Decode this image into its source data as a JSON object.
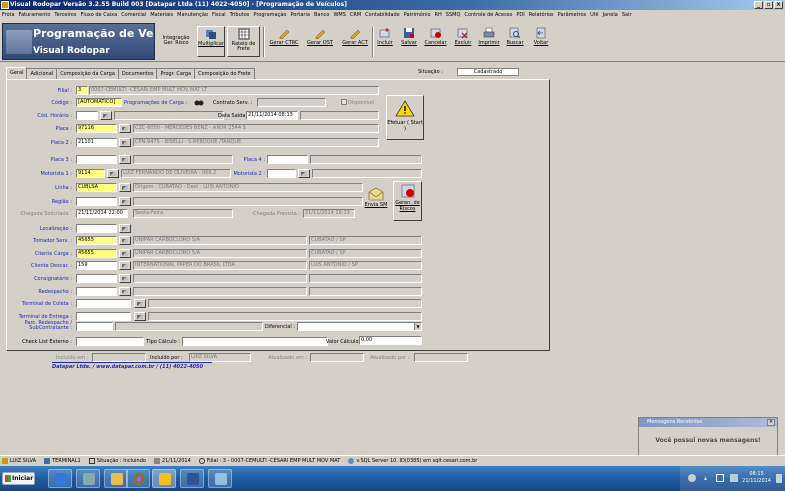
{
  "window": {
    "title": "Visual Rodopar Versão 3.2.55 Build 003 [Datapar Ltda (11) 4022-4050] - [Programação de Veículos]"
  },
  "menu": [
    "Frota",
    "Faturamento",
    "Terceiros",
    "Fluxo de Caixa",
    "Comercial",
    "Materiais",
    "Manutenção",
    "Fiscal",
    "Tributos",
    "Programação",
    "Portaria",
    "Banco",
    "WMS",
    "CRM",
    "Contabilidade",
    "Patrimônio",
    "RH",
    "SSMQ",
    "Controle de Acesso",
    "PDI",
    "Relatórios",
    "Parâmetros",
    "Util",
    "Janela",
    "Sair"
  ],
  "banner": {
    "title": "Programação de Ve",
    "subtitle": "Visual Rodopar"
  },
  "toolbar": {
    "integracao": "Integração Ger. Risco",
    "multiplicar": "Multiplicar",
    "rateio": "Rateio de Frete",
    "gerar_ctrc": "Gerar CTRC",
    "gerar_ost": "Gerar OST",
    "gerar_act": "Gerar ACT",
    "incluir": "Incluir",
    "salvar": "Salvar",
    "cancelar": "Cancelar",
    "excluir": "Excluir",
    "imprimir": "Imprimir",
    "buscar": "Buscar",
    "voltar": "Voltar"
  },
  "tabs": [
    "Geral",
    "Adicional",
    "Composição da Carga",
    "Documentos",
    "Progr. Carga",
    "Composição do Frete"
  ],
  "situacao": {
    "label": "Situação :",
    "value": "Cadastrado"
  },
  "form": {
    "filial": {
      "label": "Filial :",
      "code": "3",
      "desc": "0007-CEMULTI -CESARI EMP MULT MOV MAT LT"
    },
    "codigo": {
      "label": "Código :",
      "value": "[AUTOMATICO]",
      "programacoes": "Programações de Carga :",
      "contrato_label": "Contrato Serv. :",
      "disponivel": "Disponível"
    },
    "cod_horario": {
      "label": "Cód. Horário :",
      "saida_label": "Data Saída :",
      "saida": "21/11/2014 08:13"
    },
    "placa": {
      "label": "Placa :",
      "code": "97116",
      "desc": "CZC-6050 - MERCEDES BENZ - AXOR 2544 S"
    },
    "placa2": {
      "label": "Placa 2 :",
      "code": "21101",
      "desc": "CPN-9475 - BISELLI - S.REBOQUE /TANQUE"
    },
    "placa3": {
      "label": "Placa 3 :",
      "placa4_label": "Placa 4 :"
    },
    "motorista1": {
      "label": "Motorista 1 :",
      "code": "9114",
      "desc": "LUIZ FERNANDO DE OLIVEIRA - 066.2",
      "mot2_label": "Motorista 2 :"
    },
    "linha": {
      "label": "Linha :",
      "code": "CUBLSA",
      "desc": "Origem : CUBATAO - Dest : LUIS ANTONIO"
    },
    "regiao": {
      "label": "Região :"
    },
    "chegada": {
      "label": "Chegada Solicitada :",
      "value": "21/11/2014 22:00",
      "dia": "Sexta-Feira",
      "prevista_label": "Chegada Prevista :",
      "prevista": "21/11/2014 16:13"
    },
    "localizacao": {
      "label": "Localização :"
    },
    "tomador": {
      "label": "Tomador Serv. :",
      "code": "45655",
      "desc": "UNIPAR CARBOCLORO S/A",
      "cidade": "CUBATAO / SP"
    },
    "cliente_carga": {
      "label": "Cliente Carga :",
      "code": "45655",
      "desc": "UNIPAR CARBOCLORO S/A",
      "cidade": "CUBATAO / SP"
    },
    "cliente_descar": {
      "label": "Cliente Descar. :",
      "code": "159",
      "desc": "INTERNATIONAL PAPER DO BRASIL LTDA",
      "cidade": "LUIS ANTONIO / SP"
    },
    "consignatario": {
      "label": "Consignatário :"
    },
    "redespacho": {
      "label": "Redespacho :"
    },
    "terminal_coleta": {
      "label": "Terminal de Coleta :"
    },
    "terminal_entrega": {
      "label": "Terminal de Entrega :"
    },
    "parc_redespacho": {
      "label1": "Parc. Redespacho /",
      "label2": "SubContratante :",
      "diferencial": "Diferencial :"
    },
    "checklist": {
      "label": "Check List Externo :",
      "tipo_calculo": "Tipo Cálculo :",
      "valor_label": "Valor Cálculo :",
      "valor": "0,00"
    }
  },
  "actions": {
    "efetuar": "Efetuar ( Start )",
    "envia_sm": "Envia SM",
    "geren_riscos": "Geren. de Riscos"
  },
  "audit": {
    "incluido_em": "Incluído em :",
    "incluido_por": "Incluído por :",
    "incluido_por_value": "LUIZ.SILVA",
    "atualizado_em": "Atualizado em :",
    "atualizado_por": "Atualizado por :"
  },
  "datapar": "Datapar Ltda.  /  www.datapar.com.br / (11) 4022-4050",
  "toast": {
    "title": "Mensagens Recebidas",
    "message": "Você possui novas mensagens!"
  },
  "statusbar": {
    "user": "LUIZ.SILVA",
    "terminal": "TERMINAL1",
    "situacao": "Situação : Incluindo",
    "date": "21/11/2014",
    "filial": "Filial : 3 - 0007-CEMULTI -CESARI EMP MULT MOV MAT",
    "server": "v.SQL Server 10. ID(0385) em sqlt.cesari.com.br"
  },
  "taskbar": {
    "start": "Iniciar",
    "time": "08:15",
    "date": "21/11/2014"
  }
}
